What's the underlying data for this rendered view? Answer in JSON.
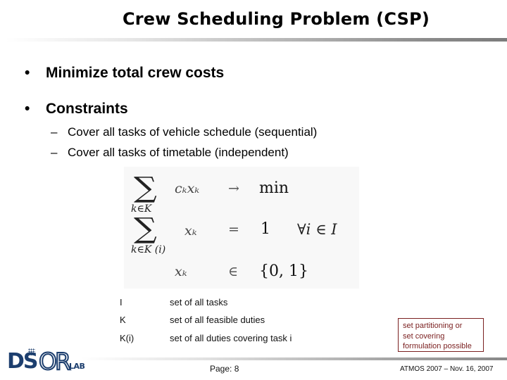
{
  "slide": {
    "title": "Crew Scheduling Problem (CSP)",
    "bullets": [
      {
        "marker": "•",
        "text": "Minimize total crew costs"
      },
      {
        "marker": "•",
        "text": "Constraints"
      }
    ],
    "sub_bullets": [
      {
        "marker": "–",
        "text": "Cover all tasks of vehicle schedule (sequential)"
      },
      {
        "marker": "–",
        "text": "Cover all tasks of timetable (independent)"
      }
    ],
    "formula": {
      "rows": [
        {
          "sum": "∑",
          "index": "k∈K",
          "term": "cₖxₖ",
          "relation": "→",
          "rhs": "min",
          "condition": ""
        },
        {
          "sum": "∑",
          "index": "k∈K (i)",
          "term": "xₖ",
          "relation": "=",
          "rhs": "1",
          "condition": "∀i ∈ I"
        },
        {
          "sum": "",
          "index": "",
          "term": "xₖ",
          "relation": "∈",
          "rhs": "{0, 1}",
          "condition": ""
        }
      ]
    },
    "legend": [
      {
        "symbol": "I",
        "description": "set of all tasks"
      },
      {
        "symbol": "K",
        "description": "set of all feasible duties"
      },
      {
        "symbol": "K(i)",
        "description": "set of all duties covering task i"
      }
    ],
    "note": {
      "lines": [
        "set partitioning  or",
        "set covering",
        "formulation possible"
      ],
      "color": "#7a1f1f"
    }
  },
  "footer": {
    "logo": {
      "main": "DSOR",
      "ds": "DS",
      "or": "OR",
      "suffix": "LAB",
      "color": "#1c3e6e"
    },
    "page": "Page: 8",
    "conference": "ATMOS 2007 – Nov. 16, 2007"
  }
}
